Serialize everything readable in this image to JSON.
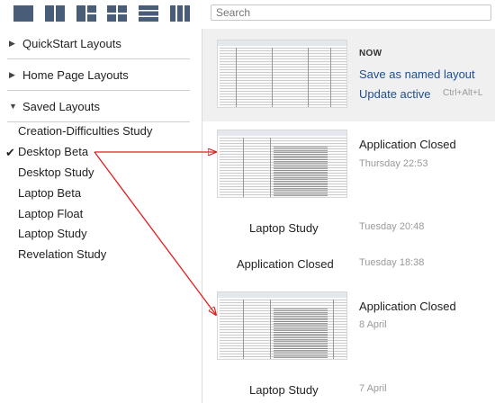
{
  "toolbar": {
    "layout_buttons": [
      "layout-single-icon",
      "layout-two-column-icon",
      "layout-one-plus-two-icon",
      "layout-quad-icon",
      "layout-rows-icon",
      "layout-three-column-icon"
    ],
    "search_placeholder": "Search"
  },
  "sidebar": {
    "sections": [
      {
        "label": "QuickStart Layouts",
        "expanded": false
      },
      {
        "label": "Home Page Layouts",
        "expanded": false
      },
      {
        "label": "Saved Layouts",
        "expanded": true
      }
    ],
    "saved_layouts": [
      "Creation-Difficulties Study",
      "Desktop Beta",
      "Desktop Study",
      "Laptop Beta",
      "Laptop Float",
      "Laptop Study",
      "Revelation Study"
    ],
    "checked_item": "Desktop Beta"
  },
  "history": {
    "now": {
      "label": "NOW",
      "save_link": "Save as named layout",
      "update_link": "Update active",
      "update_shortcut": "Ctrl+Alt+L"
    },
    "entries": [
      {
        "title": "Application Closed",
        "date": "Thursday 22:53"
      },
      {
        "title": "Laptop Study",
        "date": "Tuesday 20:48"
      },
      {
        "title": "Application Closed",
        "date": "Tuesday 18:38"
      },
      {
        "title": "Application Closed",
        "date": "8 April"
      },
      {
        "title": "Laptop Study",
        "date": "7 April"
      }
    ]
  },
  "colors": {
    "arrow": "#e01e1e",
    "link": "#1f4e8c",
    "icon": "#4a5d78"
  }
}
